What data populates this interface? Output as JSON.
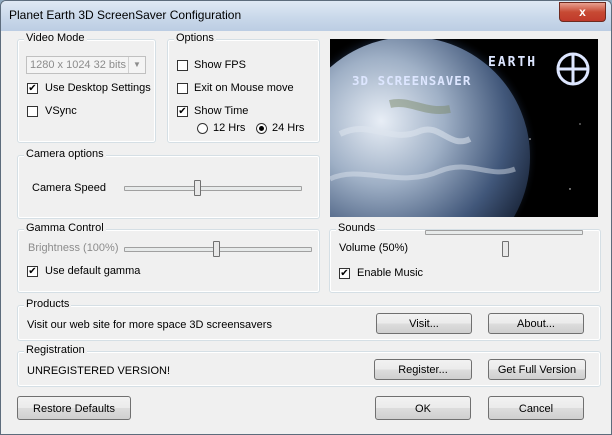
{
  "window": {
    "title": "Planet Earth 3D ScreenSaver Configuration",
    "close_glyph": "x"
  },
  "video_mode": {
    "legend": "Video Mode",
    "resolution": "1280 x 1024 32 bits",
    "use_desktop_label": "Use Desktop Settings",
    "use_desktop_checked": true,
    "vsync_label": "VSync",
    "vsync_checked": false
  },
  "options": {
    "legend": "Options",
    "show_fps_label": "Show FPS",
    "show_fps_checked": false,
    "exit_mouse_label": "Exit on Mouse move",
    "exit_mouse_checked": false,
    "show_time_label": "Show Time",
    "show_time_checked": true,
    "hrs12_label": "12 Hrs",
    "hrs24_label": "24 Hrs",
    "selected_format": "24 Hrs"
  },
  "preview": {
    "line1": "EARTH",
    "line2": "3D SCREENSAVER"
  },
  "camera": {
    "legend": "Camera options",
    "speed_label": "Camera Speed",
    "speed_level": 0.42
  },
  "gamma": {
    "legend": "Gamma Control",
    "brightness_label": "Brightness (100%)",
    "brightness_level": 0.5,
    "default_gamma_label": "Use default gamma",
    "default_gamma_checked": true
  },
  "sounds": {
    "legend": "Sounds",
    "volume_label": "Volume (50%)",
    "volume_level": 0.5,
    "music_label": "Enable Music",
    "music_checked": true
  },
  "products": {
    "legend": "Products",
    "text": "Visit our web site for more space 3D screensavers",
    "visit_label": "Visit...",
    "about_label": "About..."
  },
  "registration": {
    "legend": "Registration",
    "status": "UNREGISTERED VERSION!",
    "register_label": "Register...",
    "full_version_label": "Get Full Version"
  },
  "footer": {
    "restore_label": "Restore Defaults",
    "ok_label": "OK",
    "cancel_label": "Cancel"
  },
  "colors": {
    "titlebar": "#c9d8ea",
    "close": "#c74a34",
    "dialog_bg": "#f0f0f0"
  }
}
